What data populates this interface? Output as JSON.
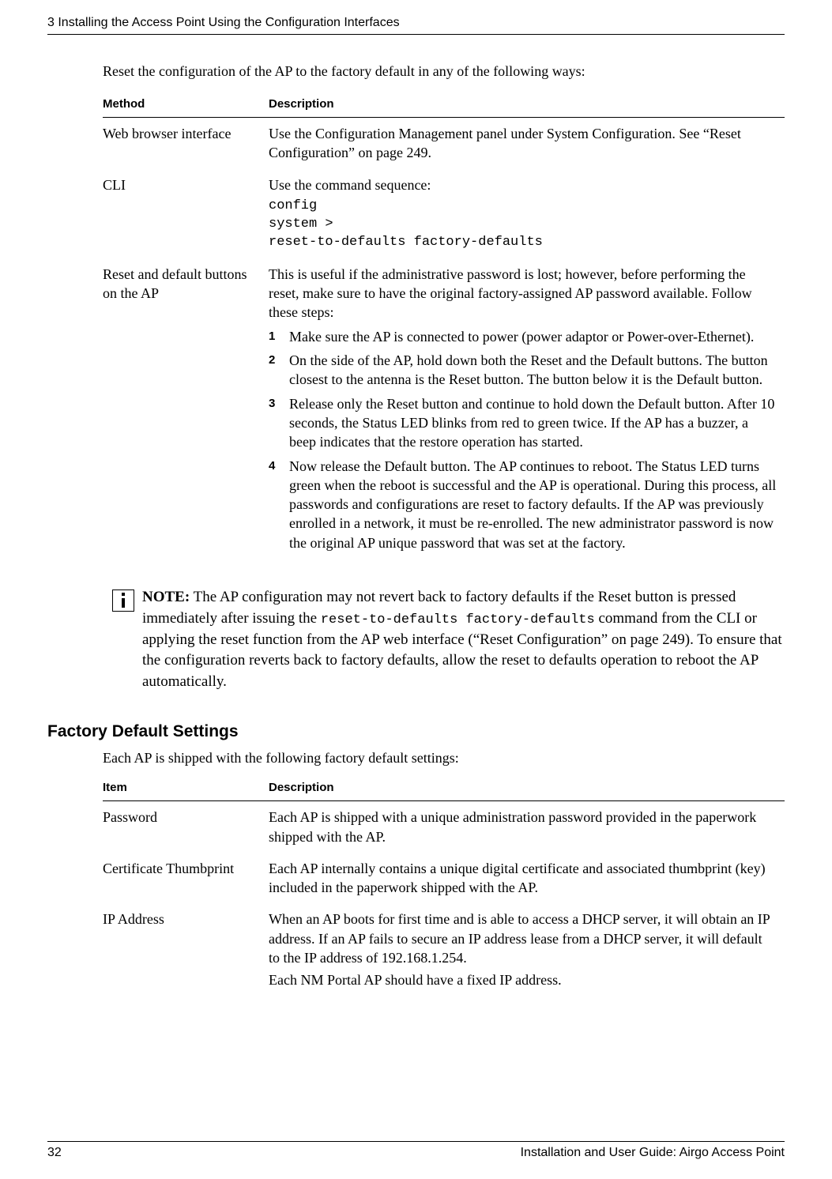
{
  "header": {
    "chapter": "3  Installing the Access Point Using the Configuration Interfaces"
  },
  "intro": "Reset the configuration of the AP to the factory default in any of the following ways:",
  "table1": {
    "headers": {
      "method": "Method",
      "description": "Description"
    },
    "rows": [
      {
        "method": "Web browser interface",
        "description": "Use the Configuration Management panel under System Configuration. See “Reset Configuration” on page 249."
      },
      {
        "method": "CLI",
        "desc_lead": "Use the command sequence:",
        "code1": "config",
        "code2": "system >",
        "code3": "reset-to-defaults factory-defaults"
      },
      {
        "method": "Reset and default buttons on the AP",
        "desc_lead": "This is useful if the administrative password is lost; however, before performing the reset, make sure to have the original factory-assigned AP password available. Follow these steps:",
        "steps": [
          "Make sure the AP is connected to power (power adaptor or Power-over-Ethernet).",
          "On the side of the AP, hold down both the Reset and the Default buttons. The button closest to the antenna is the Reset button. The button below it is the Default button.",
          "Release only the Reset button and continue to hold down the Default button. After 10 seconds, the Status LED blinks from red to green twice. If the AP has a buzzer, a beep indicates that the restore operation has started.",
          "Now release the Default button. The AP continues to reboot. The Status LED turns green when the reboot is successful and the AP is operational. During this process, all passwords and configurations are reset to factory defaults. If the AP was previously enrolled in a network, it must be re-enrolled. The new administrator password is now the original AP unique password that was set at the factory."
        ]
      }
    ]
  },
  "note": {
    "label": "NOTE:",
    "part1": " The AP configuration may not revert back to factory defaults if the Reset button is pressed immediately after issuing the ",
    "code": "reset-to-defaults factory-defaults",
    "part2": " command from the CLI or applying the reset function from the AP web interface (“Reset Configuration” on page 249). To ensure that the configuration reverts back to factory defaults, allow the reset to defaults operation to reboot the AP automatically."
  },
  "section2": {
    "heading": "Factory Default Settings",
    "intro": "Each AP is shipped with the following factory default settings:",
    "headers": {
      "item": "Item",
      "description": "Description"
    },
    "rows": [
      {
        "item": "Password",
        "description": "Each AP is shipped with a unique administration password provided in the paperwork shipped with the AP."
      },
      {
        "item": "Certificate Thumbprint",
        "description": "Each AP internally contains a unique digital certificate and associated thumbprint (key) included in the paperwork shipped with the AP."
      },
      {
        "item": "IP Address",
        "desc_p1": "When an AP boots for first time and is able to access a DHCP server, it will obtain an IP address. If an AP fails to secure an IP address lease from a DHCP server, it will default to the IP address of 192.168.1.254.",
        "desc_p2": "Each NM Portal AP should have a fixed IP address."
      }
    ]
  },
  "footer": {
    "page_number": "32",
    "doc_title": "Installation and User Guide: Airgo Access Point"
  }
}
